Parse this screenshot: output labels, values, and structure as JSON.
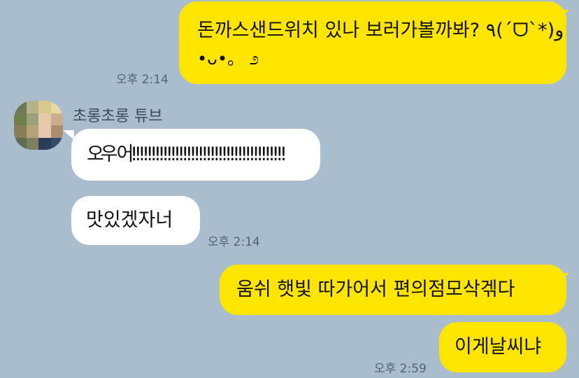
{
  "colors": {
    "background": "#A9BDCE",
    "my_bubble": "#FEE500",
    "other_bubble": "#FFFFFF",
    "timestamp": "#556271"
  },
  "messages": [
    {
      "side": "me",
      "lines": [
        "돈까스샌드위치 있나 보러가볼까봐? ٩(ˊᗜˋ*)و",
        "•ᴗ•。 ೨"
      ],
      "time": "오후 2:14"
    },
    {
      "side": "other",
      "sender": "초롱초롱 튜브",
      "avatar_icon": "pixelated-avatar",
      "lines": [
        "오우 어!!!!!!!!!!!!!!!!!!!!!!!!!!!!!!!!!!!!!!!"
      ],
      "time": ""
    },
    {
      "side": "other",
      "lines": [
        "맛있겠자너"
      ],
      "time": "오후 2:14"
    },
    {
      "side": "me",
      "lines": [
        "움쉬 햇빛 따가어서 편의점모삭겎다"
      ],
      "time": ""
    },
    {
      "side": "me",
      "lines": [
        "이게날씨냐"
      ],
      "time": "오후 2:59"
    }
  ]
}
